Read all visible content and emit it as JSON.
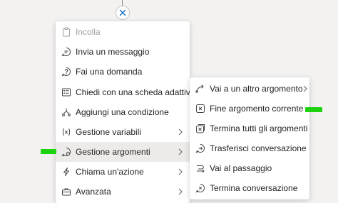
{
  "menu": {
    "items": [
      {
        "label": "Incolla",
        "icon": "paste-icon",
        "disabled": true
      },
      {
        "label": "Invia un messaggio",
        "icon": "message-icon"
      },
      {
        "label": "Fai una domanda",
        "icon": "question-icon"
      },
      {
        "label": "Chiedi con una scheda adattiva",
        "icon": "adaptive-card-icon"
      },
      {
        "label": "Aggiungi una condizione",
        "icon": "branch-icon"
      },
      {
        "label": "Gestione variabili",
        "icon": "variable-icon",
        "submenu": true
      },
      {
        "label": "Gestione argomenti",
        "icon": "topic-gear-icon",
        "submenu": true,
        "active": true
      },
      {
        "label": "Chiama un'azione",
        "icon": "lightning-icon",
        "submenu": true
      },
      {
        "label": "Avanzata",
        "icon": "toolbox-icon",
        "submenu": true
      }
    ]
  },
  "submenu": {
    "items": [
      {
        "label": "Vai a un altro argomento",
        "icon": "redirect-arrow-icon",
        "submenu": true
      },
      {
        "label": "Fine argomento corrente",
        "icon": "end-topic-icon"
      },
      {
        "label": "Termina tutti gli argomenti",
        "icon": "end-all-icon"
      },
      {
        "label": "Trasferisci conversazione",
        "icon": "transfer-icon"
      },
      {
        "label": "Vai al passaggio",
        "icon": "go-to-step-icon"
      },
      {
        "label": "Termina conversazione",
        "icon": "end-conversation-icon"
      }
    ]
  },
  "colors": {
    "highlight_marker": "#1fd20f",
    "hover_background": "#edebe9",
    "disabled_text": "#a19f9d"
  }
}
